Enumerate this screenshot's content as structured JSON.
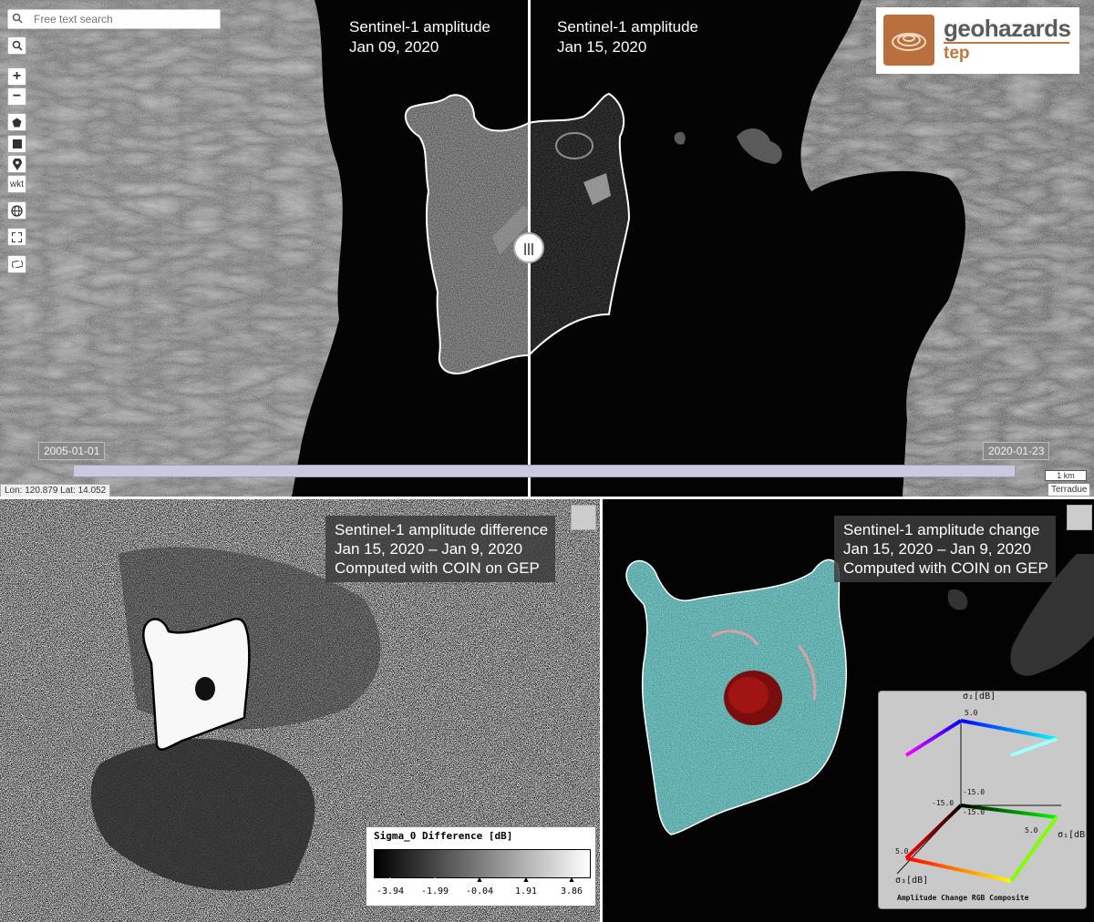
{
  "top_map": {
    "left_caption": [
      "Sentinel-1 amplitude",
      "Jan 09, 2020"
    ],
    "right_caption": [
      "Sentinel-1 amplitude",
      "Jan 15, 2020"
    ],
    "search_placeholder": "Free text search",
    "toolbar": {
      "search_icon": "search-icon",
      "zoom_in": "+",
      "zoom_out": "−",
      "polygon_icon": "polygon-icon",
      "square_icon": "square-icon",
      "marker_icon": "marker-icon",
      "wkt": "wkt",
      "globe_icon": "globe-icon",
      "fullscreen_icon": "expand-icon",
      "measure_icon": "ruler-icon"
    },
    "logo": {
      "line1": "geohazards",
      "line2": "tep"
    },
    "timeline": {
      "start": "2005-01-01",
      "end": "2020-01-23"
    },
    "coordinates": "Lon: 120.879 Lat: 14.052",
    "scale": "1 km",
    "attribution": "Terradue",
    "swipe_handle": "|||"
  },
  "bottom_left": {
    "caption": [
      "Sentinel-1 amplitude difference",
      "Jan 15, 2020 – Jan 9, 2020",
      "Computed with COIN on GEP"
    ],
    "legend": {
      "title": "Sigma_0 Difference [dB]",
      "ticks": [
        "-3.94",
        "-1.99",
        "-0.04",
        "1.91",
        "3.86"
      ]
    }
  },
  "bottom_right": {
    "caption": [
      "Sentinel-1 amplitude change",
      "Jan 15, 2020 – Jan 9, 2020",
      "Computed with COIN on GEP"
    ],
    "legend": {
      "axis_top": "σ₂[dB]",
      "axis_right": "σ₁[dB]",
      "axis_left": "σ₃[dB]",
      "val_a": "5.0",
      "val_b": "-15.0",
      "val_c": "-15.0",
      "val_d": "-15.0",
      "val_e": "5.0",
      "val_f": "5.0",
      "footer": "Amplitude Change RGB Composite"
    }
  },
  "colors": {
    "sar_dark": "#050505",
    "change_cyan": "#4fb3b3",
    "change_red": "#b01515",
    "timeline": "#c9c9df"
  }
}
